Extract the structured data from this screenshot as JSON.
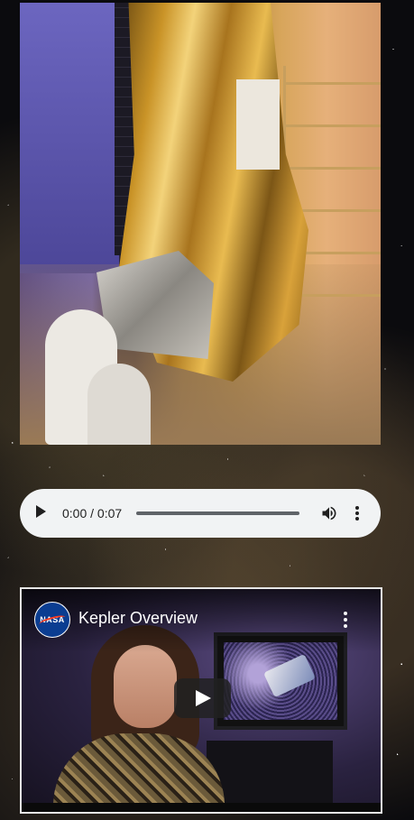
{
  "photo": {
    "alt": "Kepler spacecraft with technicians"
  },
  "audio_player": {
    "time_display": "0:00 / 0:07",
    "play_icon": "play-icon",
    "volume_icon": "volume-icon",
    "menu_icon": "more-vert-icon",
    "progress": 0,
    "background_color": "#f1f3f4"
  },
  "video": {
    "title": "Kepler Overview",
    "channel_logo_text": "NASA",
    "play_icon": "play-icon",
    "menu_icon": "more-vert-icon"
  },
  "colors": {
    "page_background": "#0b0b0e",
    "video_border": "#e6e6e6",
    "nasa_blue": "#0b3d91",
    "nasa_red": "#fc3d21"
  }
}
